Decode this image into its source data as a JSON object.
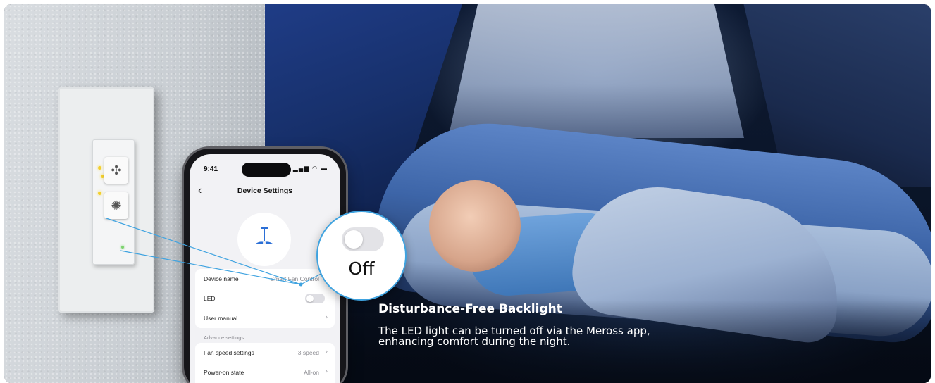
{
  "phone": {
    "time": "9:41",
    "status_icons": "signal-wifi-battery",
    "title": "Device Settings",
    "device_icon": "ceiling-fan-icon",
    "rows_top": [
      {
        "label": "Device name",
        "value": "Smart Fan Control"
      },
      {
        "label": "LED",
        "toggle": "off"
      },
      {
        "label": "User manual",
        "value": ""
      }
    ],
    "section_label": "Advance settings",
    "rows_bottom": [
      {
        "label": "Fan speed settings",
        "value": "3 speed"
      },
      {
        "label": "Power-on state",
        "value": "All-on"
      }
    ]
  },
  "callout": {
    "label": "Off",
    "toggle_state": "off"
  },
  "headline": "Disturbance-Free Backlight",
  "subcopy_line1": "The LED light can be turned off via the Meross app,",
  "subcopy_line2": "enhancing comfort during the night.",
  "colors": {
    "leader_line": "#3fa3e0",
    "led_yellow": "#f3cf2c",
    "led_green": "#7dd36f"
  }
}
